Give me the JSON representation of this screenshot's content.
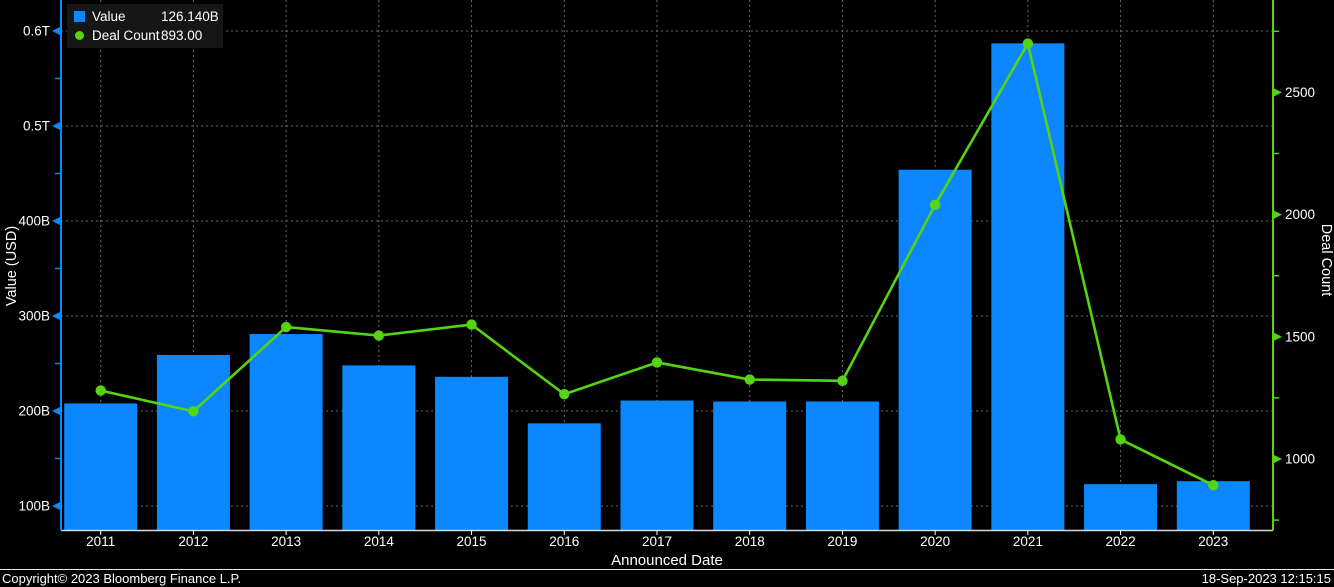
{
  "colors": {
    "background": "#000000",
    "bar_blue": "#0d87ff",
    "line_green": "#55d411",
    "grid_gray": "#6b6b6b",
    "bottom_axis": "#d9d9d9",
    "text": "#ffffff",
    "legend_bg": "#161616"
  },
  "legend": {
    "items": [
      {
        "label": "Value",
        "value": "126.140B",
        "marker": "square",
        "color": "#0d87ff"
      },
      {
        "label": "Deal Count",
        "value": "893.00",
        "marker": "circle",
        "color": "#55d411"
      }
    ]
  },
  "footer": {
    "copyright": "Copyright© 2023 Bloomberg Finance L.P.",
    "timestamp": "18-Sep-2023 12:15:15"
  },
  "chart_data": {
    "type": "bar",
    "title": "",
    "xlabel": "Announced Date",
    "categories": [
      "2011",
      "2012",
      "2013",
      "2014",
      "2015",
      "2016",
      "2017",
      "2018",
      "2019",
      "2020",
      "2021",
      "2022",
      "2023"
    ],
    "series": [
      {
        "name": "Value",
        "render": "bar",
        "axis": "left",
        "unit": "USD billions",
        "color": "#0d87ff",
        "values": [
          208,
          259,
          281,
          248,
          236,
          187,
          211,
          210,
          210,
          454,
          587,
          123,
          126.14
        ]
      },
      {
        "name": "Deal Count",
        "render": "line",
        "axis": "right",
        "color": "#55d411",
        "values": [
          1280,
          1195,
          1540,
          1505,
          1550,
          1265,
          1395,
          1325,
          1320,
          2040,
          2700,
          1080,
          893
        ]
      }
    ],
    "left_axis": {
      "title": "Value (USD)",
      "ticks": [
        {
          "v": 600,
          "label": "0.6T"
        },
        {
          "v": 500,
          "label": "0.5T"
        },
        {
          "v": 400,
          "label": "400B"
        },
        {
          "v": 300,
          "label": "300B"
        },
        {
          "v": 200,
          "label": "200B"
        },
        {
          "v": 100,
          "label": "100B"
        }
      ],
      "minor_ticks": [
        550,
        450,
        350,
        250,
        150
      ],
      "visible_range": [
        74,
        600
      ]
    },
    "right_axis": {
      "title": "Deal Count",
      "ticks": [
        {
          "v": 2500,
          "label": "2500"
        },
        {
          "v": 2000,
          "label": "2000"
        },
        {
          "v": 1500,
          "label": "1500"
        },
        {
          "v": 1000,
          "label": "1000"
        }
      ],
      "minor_ticks": [
        2750,
        2250,
        1750,
        1250,
        750
      ],
      "visible_range": [
        707,
        2755
      ]
    },
    "grid": true,
    "legend_position": "top-left"
  }
}
